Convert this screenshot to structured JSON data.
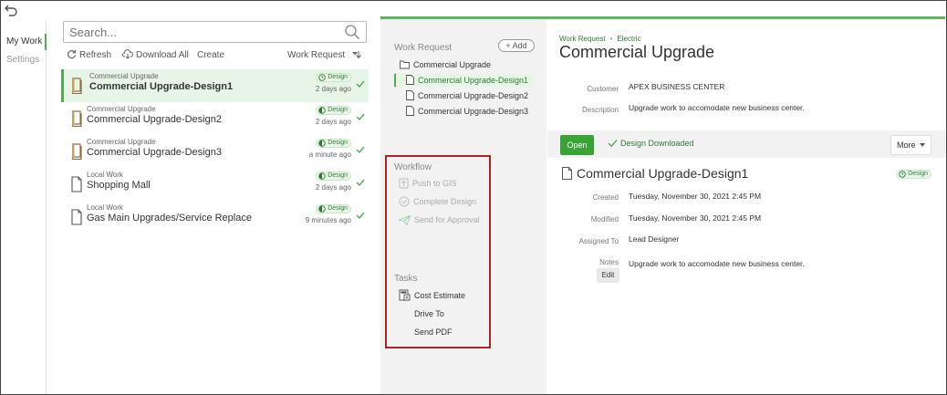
{
  "nav": {
    "my_work": "My Work",
    "settings": "Settings"
  },
  "search": {
    "placeholder": "Search..."
  },
  "toolbar": {
    "refresh": "Refresh",
    "download_all": "Download All",
    "create": "Create",
    "sort": "Work Request"
  },
  "list": [
    {
      "type": "Commercial Upgrade",
      "title": "Commercial Upgrade-Design1",
      "badge": "Design",
      "time": "2 days ago",
      "selected": true
    },
    {
      "type": "Commercial Upgrade",
      "title": "Commercial Upgrade-Design2",
      "badge": "Design",
      "time": "2 days ago"
    },
    {
      "type": "Commercial Upgrade",
      "title": "Commercial Upgrade-Design3",
      "badge": "Design",
      "time": "a minute ago"
    },
    {
      "type": "Local Work",
      "title": "Shopping Mall",
      "badge": "Design",
      "time": "2 days ago"
    },
    {
      "type": "Local Work",
      "title": "Gas Main Upgrades/Service Replace",
      "badge": "Design",
      "time": "9 minutes ago"
    }
  ],
  "middle": {
    "work_request_title": "Work Request",
    "add_label": "+ Add",
    "tree": [
      "Commercial Upgrade",
      "Commercial Upgrade-Design1",
      "Commercial Upgrade-Design2",
      "Commercial Upgrade-Design3"
    ],
    "workflow_title": "Workflow",
    "workflow": [
      "Push to GIS",
      "Complete Design",
      "Send for Approval"
    ],
    "tasks_title": "Tasks",
    "tasks": [
      "Cost Estimate",
      "Drive To",
      "Send PDF"
    ]
  },
  "detail": {
    "breadcrumb_1": "Work Request",
    "breadcrumb_sep": "•",
    "breadcrumb_2": "Electric",
    "title": "Commercial Upgrade",
    "customer_label": "Customer",
    "customer_value": "APEX BUSINESS CENTER",
    "description_label": "Description",
    "description_value": "Upgrade work to accomodate new business center.",
    "open_label": "Open",
    "status_label": "Design Downloaded",
    "more_label": "More",
    "design_title": "Commercial Upgrade-Design1",
    "design_badge": "Design",
    "created_label": "Created",
    "created_value": "Tuesday, November 30, 2021 2:45 PM",
    "modified_label": "Modified",
    "modified_value": "Tuesday, November 30, 2021 2:45 PM",
    "assigned_label": "Assigned To",
    "assigned_value": "Lead Designer",
    "notes_label": "Notes",
    "notes_value": "Upgrade work to accomodate new business center.",
    "edit_label": "Edit"
  },
  "colors": {
    "accent": "#4caf50",
    "primary_button": "#3aa335",
    "highlight_border": "#b22222"
  }
}
